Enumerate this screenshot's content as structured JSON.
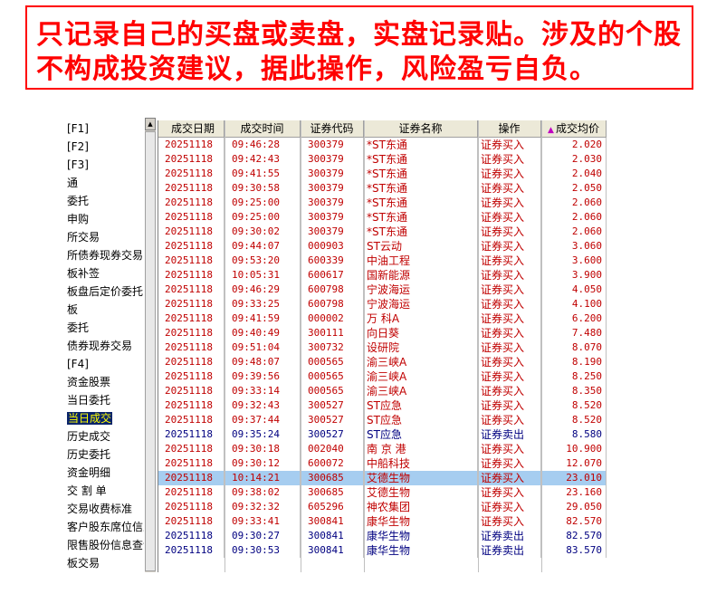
{
  "banner": {
    "text": "只记录自己的买盘或卖盘，实盘记录贴。涉及的个股不构成投资建议，据此操作，风险盈亏自负。"
  },
  "colors": {
    "banner_red": "#ff0000",
    "buy_text": "#c00000",
    "sell_text": "#000080",
    "selected_row": "#a6cdf0",
    "nav_selected_bg": "#0a246a",
    "nav_selected_text": "#ffff00"
  },
  "sidebar": {
    "items": [
      {
        "label": "[F1]"
      },
      {
        "label": "[F2]"
      },
      {
        "label": "[F3]"
      },
      {
        "label": "通"
      },
      {
        "label": "委托"
      },
      {
        "label": "申购"
      },
      {
        "label": "所交易"
      },
      {
        "label": "所债券现券交易"
      },
      {
        "label": "板补签"
      },
      {
        "label": "板盘后定价委托"
      },
      {
        "label": "板"
      },
      {
        "label": "委托"
      },
      {
        "label": "债券现券交易"
      },
      {
        "label": "[F4]"
      },
      {
        "label": "资金股票"
      },
      {
        "label": "当日委托"
      },
      {
        "label": "当日成交",
        "selected": true
      },
      {
        "label": "历史成交"
      },
      {
        "label": "历史委托"
      },
      {
        "label": "资金明细"
      },
      {
        "label": "交 割 单"
      },
      {
        "label": "交易收费标准"
      },
      {
        "label": "客户股东席位信息"
      },
      {
        "label": "限售股份信息查询"
      },
      {
        "label": "板交易"
      }
    ],
    "scroll_up_icon": "triangle-up-icon"
  },
  "table": {
    "headers": [
      "成交日期",
      "成交时间",
      "证券代码",
      "证券名称",
      "操作",
      "成交均价"
    ],
    "sort_icon": "triangle-up-icon",
    "rows": [
      [
        "20251118",
        "09:46:28",
        "300379",
        "*ST东通",
        "证券买入",
        "2.020"
      ],
      [
        "20251118",
        "09:42:43",
        "300379",
        "*ST东通",
        "证券买入",
        "2.030"
      ],
      [
        "20251118",
        "09:41:55",
        "300379",
        "*ST东通",
        "证券买入",
        "2.040"
      ],
      [
        "20251118",
        "09:30:58",
        "300379",
        "*ST东通",
        "证券买入",
        "2.050"
      ],
      [
        "20251118",
        "09:25:00",
        "300379",
        "*ST东通",
        "证券买入",
        "2.060"
      ],
      [
        "20251118",
        "09:25:00",
        "300379",
        "*ST东通",
        "证券买入",
        "2.060"
      ],
      [
        "20251118",
        "09:30:02",
        "300379",
        "*ST东通",
        "证券买入",
        "2.060"
      ],
      [
        "20251118",
        "09:44:07",
        "000903",
        "ST云动",
        "证券买入",
        "3.060"
      ],
      [
        "20251118",
        "09:53:20",
        "600339",
        "中油工程",
        "证券买入",
        "3.600"
      ],
      [
        "20251118",
        "10:05:31",
        "600617",
        "国新能源",
        "证券买入",
        "3.900"
      ],
      [
        "20251118",
        "09:46:29",
        "600798",
        "宁波海运",
        "证券买入",
        "4.050"
      ],
      [
        "20251118",
        "09:33:25",
        "600798",
        "宁波海运",
        "证券买入",
        "4.100"
      ],
      [
        "20251118",
        "09:41:59",
        "000002",
        "万 科A",
        "证券买入",
        "6.200"
      ],
      [
        "20251118",
        "09:40:49",
        "300111",
        "向日葵",
        "证券买入",
        "7.480"
      ],
      [
        "20251118",
        "09:51:04",
        "300732",
        "设研院",
        "证券买入",
        "8.070"
      ],
      [
        "20251118",
        "09:48:07",
        "000565",
        "渝三峡A",
        "证券买入",
        "8.190"
      ],
      [
        "20251118",
        "09:39:56",
        "000565",
        "渝三峡A",
        "证券买入",
        "8.250"
      ],
      [
        "20251118",
        "09:33:14",
        "000565",
        "渝三峡A",
        "证券买入",
        "8.350"
      ],
      [
        "20251118",
        "09:32:43",
        "300527",
        "ST应急",
        "证券买入",
        "8.520"
      ],
      [
        "20251118",
        "09:37:44",
        "300527",
        "ST应急",
        "证券买入",
        "8.520"
      ],
      [
        "20251118",
        "09:35:24",
        "300527",
        "ST应急",
        "证券卖出",
        "8.580"
      ],
      [
        "20251118",
        "09:30:18",
        "002040",
        "南 京 港",
        "证券买入",
        "10.900"
      ],
      [
        "20251118",
        "09:30:12",
        "600072",
        "中船科技",
        "证券买入",
        "12.070"
      ],
      [
        "20251118",
        "10:14:21",
        "300685",
        "艾德生物",
        "证券买入",
        "23.010"
      ],
      [
        "20251118",
        "09:38:02",
        "300685",
        "艾德生物",
        "证券买入",
        "23.160"
      ],
      [
        "20251118",
        "09:32:32",
        "605296",
        "神农集团",
        "证券买入",
        "29.050"
      ],
      [
        "20251118",
        "09:33:41",
        "300841",
        "康华生物",
        "证券买入",
        "82.570"
      ],
      [
        "20251118",
        "09:30:27",
        "300841",
        "康华生物",
        "证券卖出",
        "82.570"
      ],
      [
        "20251118",
        "09:30:53",
        "300841",
        "康华生物",
        "证券卖出",
        "83.570"
      ]
    ],
    "highlighted_row": 23
  }
}
